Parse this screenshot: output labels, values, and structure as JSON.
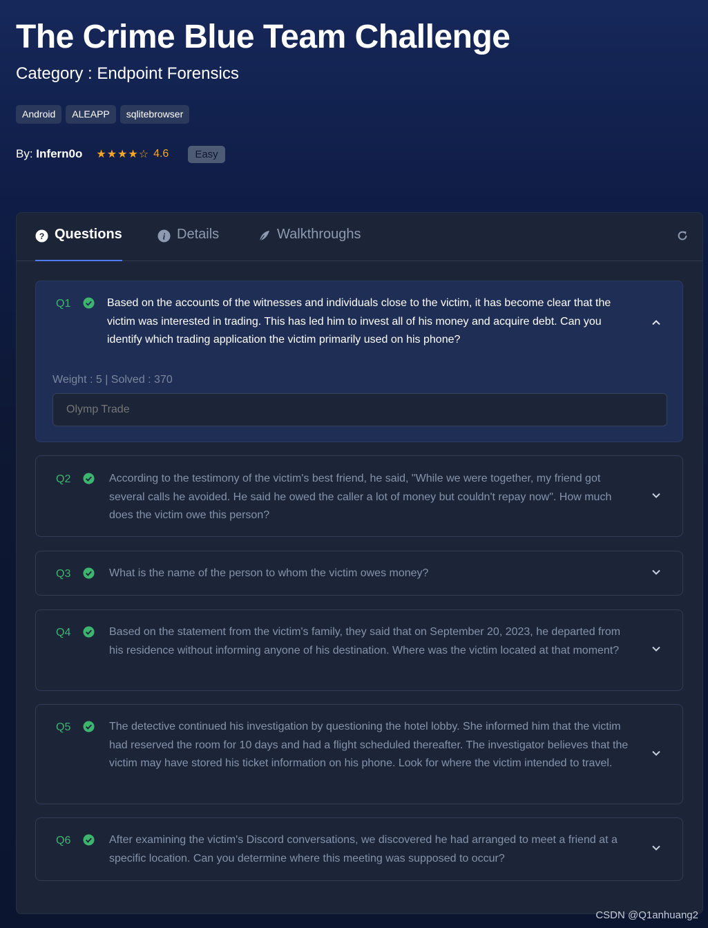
{
  "challenge": {
    "title": "The Crime Blue Team Challenge",
    "category": "Category : Endpoint Forensics",
    "tags": [
      "Android",
      "ALEAPP",
      "sqlitebrowser"
    ],
    "by_label": "By: ",
    "author": "Infern0o",
    "stars": "★★★★☆",
    "rating": "4.6",
    "difficulty": "Easy"
  },
  "tabs": {
    "questions": "Questions",
    "details": "Details",
    "walkthroughs": "Walkthroughs"
  },
  "questions": [
    {
      "num": "Q1",
      "text": "Based on the accounts of the witnesses and individuals close to the victim, it has become clear that the victim was interested in trading. This has led him to invest all of his money and acquire debt. Can you identify which trading application the victim primarily used on his phone?",
      "weight_line": "Weight : 5 | Solved : 370",
      "answer_placeholder": "Olymp Trade"
    },
    {
      "num": "Q2",
      "text": "According to the testimony of the victim's best friend, he said, \"While we were together, my friend got several calls he avoided. He said he owed the caller a lot of money but couldn't repay now\". How much does the victim owe this person?"
    },
    {
      "num": "Q3",
      "text": "What is the name of the person to whom the victim owes money?"
    },
    {
      "num": "Q4",
      "text": "Based on the statement from the victim's family, they said that on September 20, 2023, he departed from his residence without informing anyone of his destination. Where was the victim located at that moment?"
    },
    {
      "num": "Q5",
      "text": "The detective continued his investigation by questioning the hotel lobby. She informed him that the victim had reserved the room for 10 days and had a flight scheduled thereafter. The investigator believes that the victim may have stored his ticket information on his phone. Look for where the victim intended to travel."
    },
    {
      "num": "Q6",
      "text": "After examining the victim's Discord conversations, we discovered he had arranged to meet a friend at a specific location. Can you determine where this meeting was supposed to occur?"
    }
  ],
  "watermark": "CSDN @Q1anhuang2",
  "colors": {
    "accent": "#4f7bf0",
    "solved_green": "#3db56e",
    "star": "#f5a623"
  }
}
